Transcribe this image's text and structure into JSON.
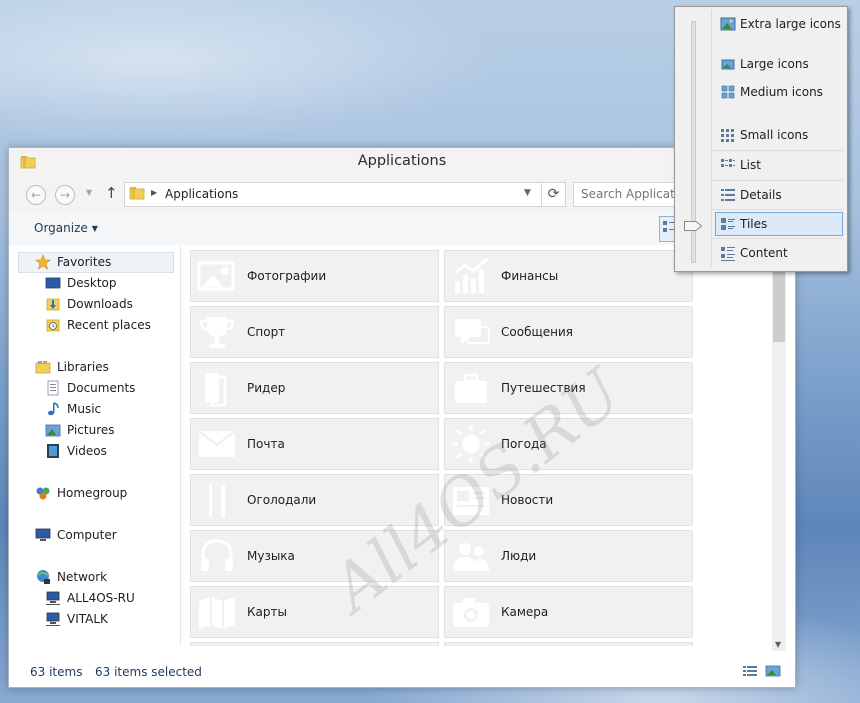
{
  "window": {
    "title": "Applications"
  },
  "address": {
    "path": "Applications",
    "search_placeholder": "Search Applications"
  },
  "toolbar": {
    "organize_label": "Organize"
  },
  "sidebar": {
    "favorites": "Favorites",
    "desktop": "Desktop",
    "downloads": "Downloads",
    "recent_places": "Recent places",
    "libraries": "Libraries",
    "documents": "Documents",
    "music": "Music",
    "pictures": "Pictures",
    "videos": "Videos",
    "homegroup": "Homegroup",
    "computer": "Computer",
    "network": "Network",
    "network_pc1": "ALL4OS-RU",
    "network_pc2": "VITALK"
  },
  "tiles": [
    {
      "label": "Фотографии",
      "icon": "photo-icon"
    },
    {
      "label": "Финансы",
      "icon": "chart-icon"
    },
    {
      "label": "Спорт",
      "icon": "trophy-icon"
    },
    {
      "label": "Сообщения",
      "icon": "chat-icon"
    },
    {
      "label": "Ридер",
      "icon": "reader-icon"
    },
    {
      "label": "Путешествия",
      "icon": "suitcase-icon"
    },
    {
      "label": "Почта",
      "icon": "mail-icon"
    },
    {
      "label": "Погода",
      "icon": "sun-icon"
    },
    {
      "label": "Оголодали",
      "icon": "cutlery-icon"
    },
    {
      "label": "Новости",
      "icon": "newspaper-icon"
    },
    {
      "label": "Музыка",
      "icon": "headphones-icon"
    },
    {
      "label": "Люди",
      "icon": "people-icon"
    },
    {
      "label": "Карты",
      "icon": "map-icon"
    },
    {
      "label": "Камера",
      "icon": "camera-icon"
    }
  ],
  "status": {
    "items_count": "63 items",
    "selected_count": "63 items selected"
  },
  "view_menu": {
    "extra_large": "Extra large icons",
    "large": "Large icons",
    "medium": "Medium icons",
    "small": "Small icons",
    "list": "List",
    "details": "Details",
    "tiles": "Tiles",
    "content": "Content",
    "selected": "Tiles"
  },
  "watermark": "All4OS.RU",
  "colors": {
    "accent": "#1e395b",
    "selection": "#dbe9f8",
    "selection_border": "#7fa9d8",
    "tile_bg": "#f1f1f1"
  }
}
